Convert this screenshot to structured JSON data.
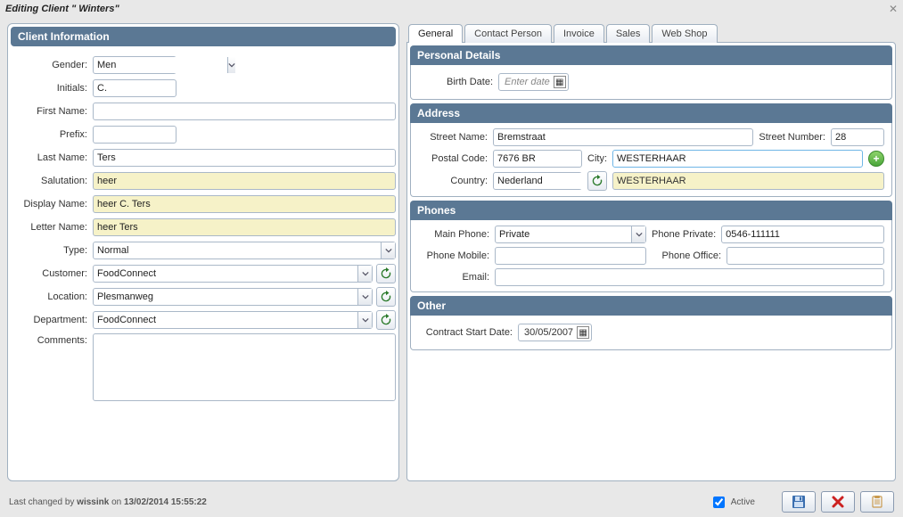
{
  "window": {
    "title": "Editing Client \"  Winters\""
  },
  "left": {
    "heading": "Client Information",
    "gender": {
      "label": "Gender:",
      "value": "Men"
    },
    "initials": {
      "label": "Initials:",
      "value": "C."
    },
    "first_name": {
      "label": "First Name:",
      "value": ""
    },
    "prefix": {
      "label": "Prefix:",
      "value": ""
    },
    "last_name": {
      "label": "Last Name:",
      "value": "Ters"
    },
    "salutation": {
      "label": "Salutation:",
      "value": "heer"
    },
    "display_name": {
      "label": "Display Name:",
      "value": "heer C. Ters"
    },
    "letter_name": {
      "label": "Letter Name:",
      "value": "heer Ters"
    },
    "type": {
      "label": "Type:",
      "value": "Normal"
    },
    "customer": {
      "label": "Customer:",
      "value": "FoodConnect"
    },
    "location": {
      "label": "Location:",
      "value": "Plesmanweg"
    },
    "department": {
      "label": "Department:",
      "value": "FoodConnect"
    },
    "comments": {
      "label": "Comments:",
      "value": ""
    }
  },
  "tabs": {
    "general": "General",
    "contact_person": "Contact Person",
    "invoice": "Invoice",
    "sales": "Sales",
    "web_shop": "Web Shop"
  },
  "personal": {
    "heading": "Personal Details",
    "birth_date": {
      "label": "Birth Date:",
      "placeholder": "Enter date"
    }
  },
  "address": {
    "heading": "Address",
    "street_name": {
      "label": "Street Name:",
      "value": "Bremstraat"
    },
    "street_number": {
      "label": "Street Number:",
      "value": "28"
    },
    "postal_code": {
      "label": "Postal Code:",
      "value": "7676 BR"
    },
    "city": {
      "label": "City:",
      "value": "WESTERHAAR"
    },
    "country": {
      "label": "Country:",
      "value": "Nederland"
    },
    "city_suggest": "WESTERHAAR"
  },
  "phones": {
    "heading": "Phones",
    "main_phone": {
      "label": "Main Phone:",
      "value": "Private"
    },
    "phone_private": {
      "label": "Phone Private:",
      "value": "0546-111111"
    },
    "phone_mobile": {
      "label": "Phone Mobile:",
      "value": ""
    },
    "phone_office": {
      "label": "Phone Office:",
      "value": ""
    },
    "email": {
      "label": "Email:",
      "value": ""
    }
  },
  "other": {
    "heading": "Other",
    "contract_start": {
      "label": "Contract Start Date:",
      "value": "30/05/2007"
    }
  },
  "footer": {
    "prefix": "Last changed by ",
    "user": "wissink",
    "middle": " on ",
    "timestamp": "13/02/2014 15:55:22",
    "active_label": "Active"
  }
}
